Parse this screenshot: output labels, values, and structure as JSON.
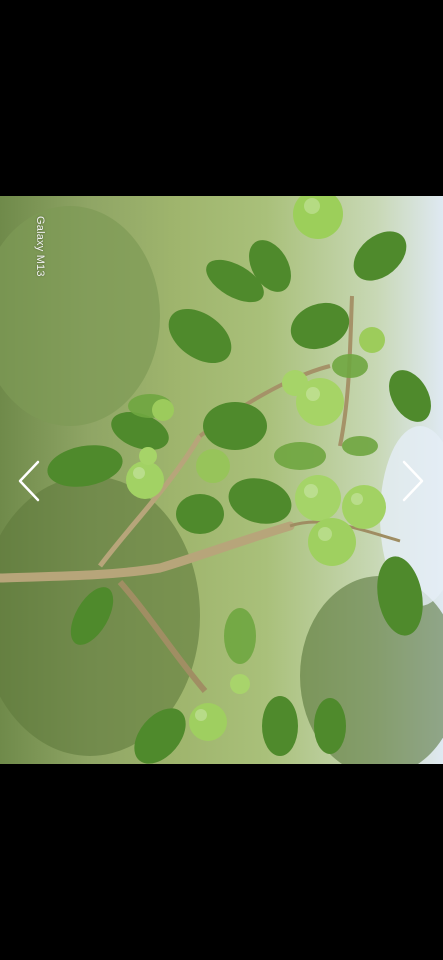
{
  "viewer": {
    "background_color": "#000000",
    "photo": {
      "watermark_text": "Galaxy M13",
      "subject": "apple-tree-branch"
    },
    "navigation": {
      "prev_icon": "chevron-left-icon",
      "next_icon": "chevron-right-icon"
    }
  }
}
